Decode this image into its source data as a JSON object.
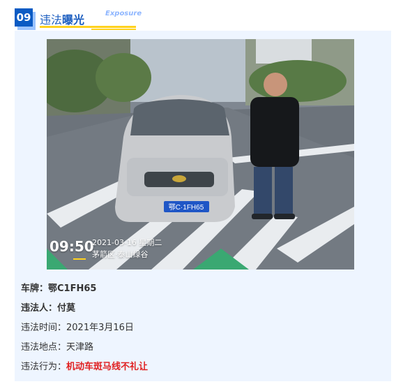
{
  "header": {
    "number": "09",
    "title_prefix": "违法",
    "title_highlight": "曝光",
    "title_en": "Exposure"
  },
  "photo": {
    "time": "09:50",
    "date": "2021-03-16 星期二",
    "location": "茅箭区·泰山绿谷",
    "plate": "鄂C·1FH65"
  },
  "details": {
    "plate_label": "车牌：",
    "plate_value": "鄂C1FH65",
    "person_label": "违法人：",
    "person_value": "付莫",
    "time_label": "违法时间：",
    "time_value": "2021年3月16日",
    "place_label": "违法地点：",
    "place_value": "天津路",
    "behavior_label": "违法行为：",
    "behavior_value": "机动车斑马线不礼让"
  },
  "colors": {
    "accent": "#1e5fc0",
    "highlight": "#ffd21f",
    "violation": "#e02020",
    "card_bg": "#eef5ff"
  }
}
